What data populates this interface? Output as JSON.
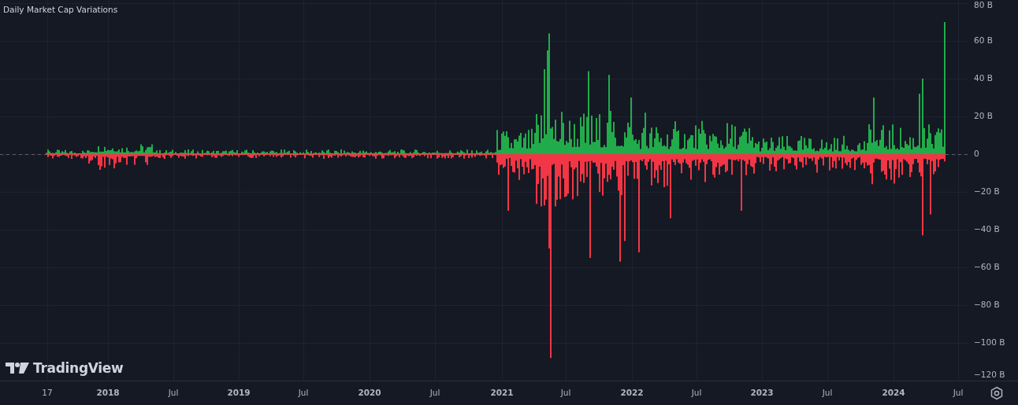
{
  "chart": {
    "title": "Daily Market Cap Variations",
    "kind": "picture",
    "y_axis": [
      "80 B",
      "60 B",
      "40 B",
      "20 B",
      "0",
      "−20 B",
      "−40 B",
      "−60 B",
      "−80 B",
      "−100 B",
      "−120 B"
    ],
    "x_axis": [
      "17",
      "2018",
      "Jul",
      "2019",
      "Jul",
      "2020",
      "Jul",
      "2021",
      "Jul",
      "2022",
      "Jul",
      "2023",
      "Jul",
      "2024",
      "Jul"
    ]
  },
  "logo": {
    "text": "TradingView"
  }
}
